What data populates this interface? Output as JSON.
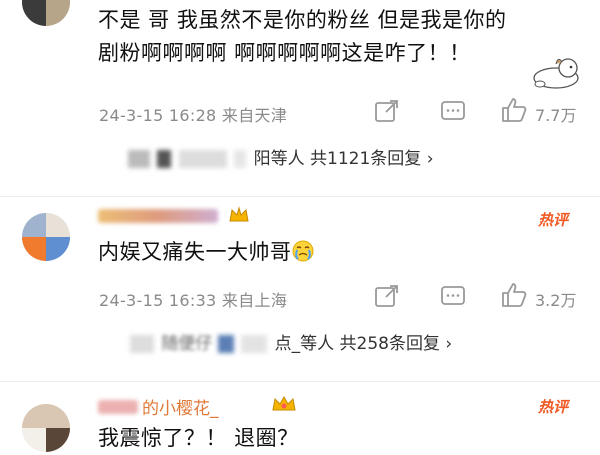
{
  "comments": [
    {
      "text_line1": "不是 哥 我虽然不是你的粉丝 但是我是你的",
      "text_line2": "剧粉啊啊啊啊 啊啊啊啊啊这是咋了！！",
      "meta": "24-3-15 16:28 来自天津",
      "likes": "7.7万",
      "replies_text": "阳等人 共1121条回复 ›"
    },
    {
      "hot_badge": "热评",
      "text": "内娱又痛失一大帅哥",
      "meta": "24-3-15 16:33 来自上海",
      "likes": "3.2万",
      "replies_text": "点_等人 共258条回复 ›",
      "reply_names_partial": "随便仔"
    },
    {
      "name_partial": "的小樱花_",
      "hot_badge": "热评",
      "text": "我震惊了？！ 退圈？"
    }
  ],
  "colors": {
    "hot": "#f15a24",
    "meta": "#8a8a8a",
    "text": "#111111"
  },
  "icons": [
    "share-icon",
    "comment-icon",
    "like-icon",
    "crown-icon",
    "crying-emoji-icon",
    "dog-sticker-icon"
  ]
}
